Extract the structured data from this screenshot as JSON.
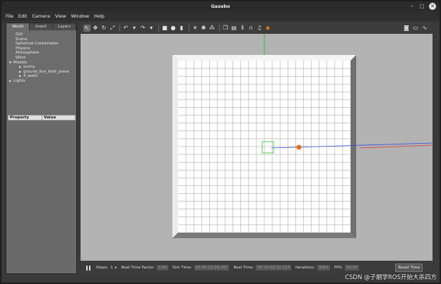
{
  "window": {
    "title": "Gazebo",
    "minimize": "–",
    "maximize": "□",
    "close": "✕"
  },
  "menu": [
    "File",
    "Edit",
    "Camera",
    "View",
    "Window",
    "Help"
  ],
  "left_panel": {
    "tabs": [
      "World",
      "Insert",
      "Layers"
    ],
    "active_tab": "World",
    "tree": {
      "gui": "GUI",
      "scene": "Scene",
      "spherical": "Spherical Coordinates",
      "physics": "Physics",
      "atmosphere": "Atmosphere",
      "wind": "Wind",
      "models": "Models",
      "model_items": [
        "sunny",
        "ground_line_field_plane",
        "4_walls"
      ],
      "lights": "Lights"
    },
    "property_header": {
      "property": "Property",
      "value": "Value"
    }
  },
  "toolbar": {
    "tools": [
      {
        "name": "select-tool-icon",
        "glyph": "↖",
        "active": true
      },
      {
        "name": "translate-tool-icon",
        "glyph": "✥"
      },
      {
        "name": "rotate-tool-icon",
        "glyph": "↻"
      },
      {
        "name": "scale-tool-icon",
        "glyph": "⤢"
      }
    ],
    "history": [
      {
        "name": "undo-icon",
        "glyph": "↶"
      },
      {
        "name": "undo-dropdown-icon",
        "glyph": "▾"
      },
      {
        "name": "redo-icon",
        "glyph": "↷"
      },
      {
        "name": "redo-dropdown-icon",
        "glyph": "▾"
      }
    ],
    "shapes": [
      {
        "name": "box-shape-icon",
        "glyph": "■"
      },
      {
        "name": "sphere-shape-icon",
        "glyph": "●"
      },
      {
        "name": "cylinder-shape-icon",
        "glyph": "▮"
      }
    ],
    "lights": [
      {
        "name": "point-light-icon",
        "glyph": "☀"
      },
      {
        "name": "spot-light-icon",
        "glyph": "✺"
      },
      {
        "name": "directional-light-icon",
        "glyph": "⁂"
      }
    ],
    "edit": [
      {
        "name": "copy-icon",
        "glyph": "❐"
      },
      {
        "name": "paste-icon",
        "glyph": "▤"
      },
      {
        "name": "align-icon",
        "glyph": "⫴"
      },
      {
        "name": "snap-icon",
        "glyph": "∩"
      },
      {
        "name": "audio-icon",
        "glyph": "♫"
      },
      {
        "name": "view-angle-icon",
        "glyph": "◆",
        "color": "#e07020"
      }
    ],
    "right": [
      {
        "name": "screenshot-camera-icon",
        "glyph": "◙"
      },
      {
        "name": "log-icon",
        "glyph": "▭"
      },
      {
        "name": "plot-icon",
        "glyph": "∿"
      }
    ]
  },
  "bottom_bar": {
    "steps_label": "Steps:",
    "steps_value": "1",
    "rtf_label": "Real Time Factor:",
    "rtf_value": "0.94",
    "sim_time_label": "Sim Time:",
    "sim_time_value": "00 00:02:19.267",
    "real_time_label": "Real Time:",
    "real_time_value": "00 00:02:31.223",
    "iterations_label": "Iterations:",
    "iterations_value": "9001",
    "fps_label": "FPS:",
    "fps_value": "59.97",
    "reset_label": "Reset Time"
  },
  "watermark": "CSDN @子期学ROS开始大杀四方",
  "colors": {
    "accent_orange": "#e07020",
    "axis_green": "#2fc02f",
    "axis_blue": "#3050e0",
    "axis_red": "#e03030"
  }
}
